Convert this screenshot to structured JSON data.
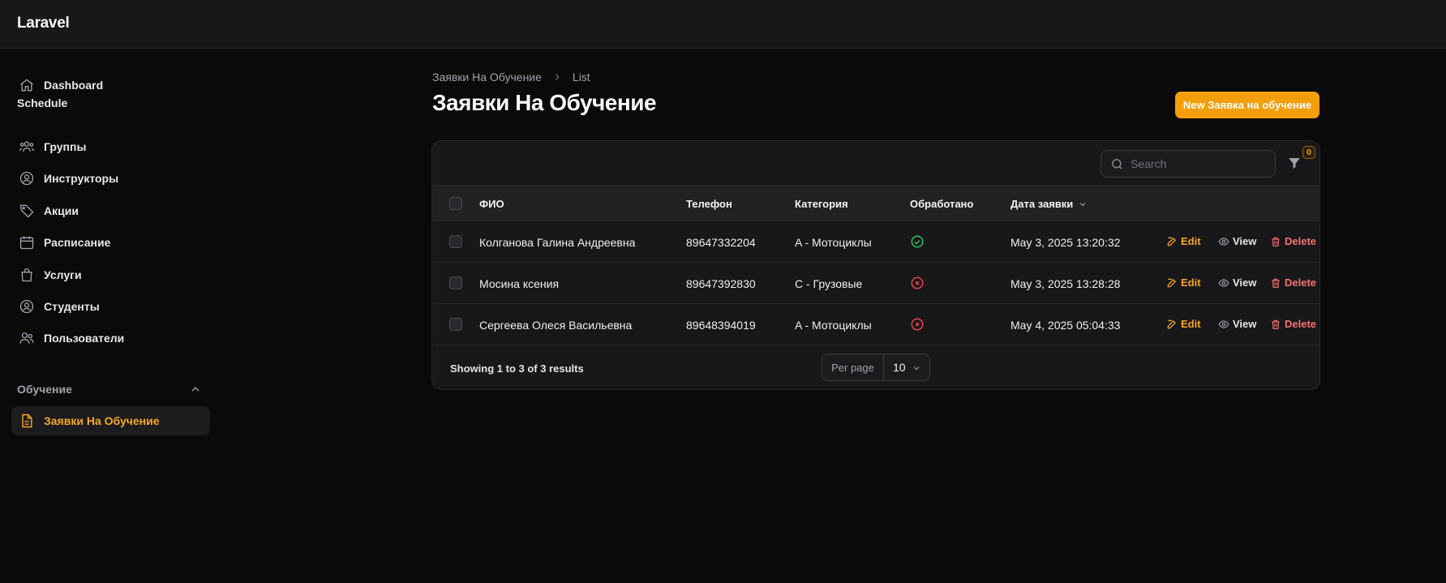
{
  "app": {
    "brand": "Laravel"
  },
  "sidebar": {
    "items": [
      {
        "label": "Dashboard",
        "icon": "home-icon"
      },
      {
        "label": "Группы",
        "icon": "users-group-icon"
      },
      {
        "label": "Инструкторы",
        "icon": "user-circle-icon"
      },
      {
        "label": "Акции",
        "icon": "tag-icon"
      },
      {
        "label": "Расписание",
        "icon": "calendar-icon"
      },
      {
        "label": "Услуги",
        "icon": "shopping-bag-icon"
      },
      {
        "label": "Студенты",
        "icon": "user-circle-icon"
      },
      {
        "label": "Пользователи",
        "icon": "users-icon"
      },
      {
        "label": "Заявки На Обучение",
        "icon": "document-icon",
        "active": true
      }
    ],
    "groups": {
      "schedule": "Schedule",
      "education": "Обучение"
    }
  },
  "breadcrumb": {
    "parent": "Заявки На Обучение",
    "current": "List"
  },
  "page": {
    "title": "Заявки На Обучение",
    "new_button": "New Заявка на обучение"
  },
  "search": {
    "placeholder": "Search"
  },
  "filter": {
    "count": "0"
  },
  "table": {
    "columns": {
      "name": "ФИО",
      "phone": "Телефон",
      "category": "Категория",
      "processed": "Обработано",
      "date": "Дата заявки"
    },
    "rows": [
      {
        "name": "Колганова Галина Андреевна",
        "phone": "89647332204",
        "category": "A - Мотоциклы",
        "processed": true,
        "date": "May 3, 2025 13:20:32"
      },
      {
        "name": "Мосина ксения",
        "phone": "89647392830",
        "category": "C - Грузовые",
        "processed": false,
        "date": "May 3, 2025 13:28:28"
      },
      {
        "name": "Сергеева Олеся Васильевна",
        "phone": "89648394019",
        "category": "A - Мотоциклы",
        "processed": false,
        "date": "May 4, 2025 05:04:33"
      }
    ],
    "actions": {
      "edit": "Edit",
      "view": "View",
      "delete": "Delete"
    }
  },
  "pagination": {
    "showing": "Showing 1 to 3 of 3 results",
    "per_page_label": "Per page",
    "per_page_value": "10"
  },
  "colors": {
    "accent": "#f59e0b",
    "success": "#22c55e",
    "danger": "#ef4444",
    "background": "#0a0a0b"
  }
}
